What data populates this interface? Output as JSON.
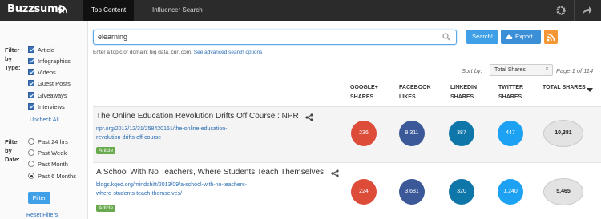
{
  "topbar": {
    "logo": "Buzzsumo",
    "tabs": [
      "Top Content",
      "Influencer Search"
    ]
  },
  "filters": {
    "type_label": "Filter by Type:",
    "types": [
      {
        "label": "Article",
        "checked": true
      },
      {
        "label": "Infographics",
        "checked": true
      },
      {
        "label": "Videos",
        "checked": true
      },
      {
        "label": "Guest Posts",
        "checked": true
      },
      {
        "label": "Giveaways",
        "checked": true
      },
      {
        "label": "Interviews",
        "checked": true
      }
    ],
    "uncheck_all": "Uncheck All",
    "date_label": "Filter by Date:",
    "dates": [
      {
        "label": "Past 24 hrs",
        "selected": false
      },
      {
        "label": "Past Week",
        "selected": false
      },
      {
        "label": "Past Month",
        "selected": false
      },
      {
        "label": "Past 6 Months",
        "selected": true
      }
    ],
    "filter_button": "Filter",
    "reset": "Reset Filters"
  },
  "search": {
    "value": "elearning",
    "hint": "Enter a topic or domain: big data, cnn.com.",
    "advanced": "See advanced search options",
    "search_button": "Search!",
    "export_button": "Export"
  },
  "sort": {
    "label": "Sort by:",
    "selected": "Total Shares",
    "page_info": "Page 1 of 114"
  },
  "columns": {
    "google": [
      "GOOGLE+",
      "SHARES"
    ],
    "facebook": [
      "FACEBOOK",
      "LIKES"
    ],
    "linkedin": [
      "LINKEDIN",
      "SHARES"
    ],
    "twitter": [
      "TWITTER",
      "SHARES"
    ],
    "total": [
      "TOTAL SHARES"
    ]
  },
  "colors": {
    "google": "#dd4b39",
    "facebook": "#3b5998",
    "linkedin": "#0e76a8",
    "twitter": "#1da1f2"
  },
  "results": [
    {
      "title": "The Online Education Revolution Drifts Off Course : NPR",
      "url_line1": "npr.org/2013/12/31/258420151/the-online-education-",
      "url_line2": "revolution-drifts-off-course",
      "type": "Article",
      "google": "236",
      "facebook": "9,311",
      "linkedin": "387",
      "twitter": "447",
      "total": "10,381"
    },
    {
      "title": "A School With No Teachers, Where Students Teach Themselves",
      "url_line1": "blogs.kqed.org/mindshift/2013/09/a-school-with-no-teachers-",
      "url_line2": "where-students-teach-themselves/",
      "type": "Article",
      "google": "224",
      "facebook": "3,681",
      "linkedin": "320",
      "twitter": "1,240",
      "total": "5,465"
    }
  ]
}
